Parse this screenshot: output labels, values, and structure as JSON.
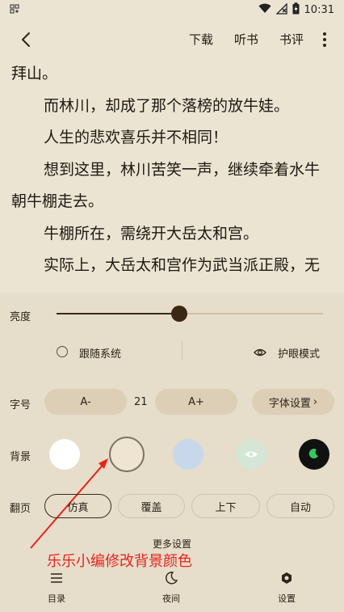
{
  "status_bar": {
    "time": "10:31",
    "left_icon": "qr-notification-icon",
    "icons": [
      "wifi-icon",
      "no-signal-icon",
      "battery-charging-icon"
    ]
  },
  "top_bar": {
    "back_icon": "back-arrow-icon",
    "actions": [
      "下载",
      "听书",
      "书评"
    ],
    "more_icon": "more-vertical-icon"
  },
  "content": {
    "lines": [
      {
        "text": "拜山。",
        "indent": false
      },
      {
        "text": "而林川，却成了那个落榜的放牛娃。",
        "indent": true
      },
      {
        "text": "人生的悲欢喜乐并不相同！",
        "indent": true
      },
      {
        "text": "想到这里，林川苦笑一声，继续牵着水牛",
        "indent": true
      },
      {
        "text": "朝牛棚走去。",
        "indent": false
      },
      {
        "text": "牛棚所在，需绕开大岳太和宫。",
        "indent": true
      },
      {
        "text": "实际上，大岳太和宫作为武当派正殿，无",
        "indent": true
      }
    ]
  },
  "settings": {
    "brightness": {
      "label": "亮度",
      "level": 0.46
    },
    "follow_system": {
      "label": "跟随系统",
      "checked": false
    },
    "eye_care": {
      "label": "护眼模式",
      "icon": "eye-icon"
    },
    "font_size": {
      "label": "字号",
      "decrease": "A-",
      "value": "21",
      "increase": "A+",
      "font_settings": "字体设置"
    },
    "background": {
      "label": "背景",
      "swatches": [
        {
          "name": "white",
          "color": "#ffffff"
        },
        {
          "name": "parchment",
          "color": "#efe3d2",
          "selected": true
        },
        {
          "name": "blue",
          "color": "#c8d8ea"
        },
        {
          "name": "green-eye",
          "color": "#d6e6d6",
          "icon": "eye-icon"
        },
        {
          "name": "night",
          "color": "#111111",
          "icon": "moon-icon"
        }
      ]
    },
    "page_turn": {
      "label": "翻页",
      "options": [
        "仿真",
        "覆盖",
        "上下",
        "自动"
      ],
      "selected": "仿真"
    },
    "more": "更多设置"
  },
  "annotation": "乐乐小编修改背景颜色",
  "bottom_nav": [
    {
      "label": "目录",
      "icon": "menu-list-icon"
    },
    {
      "label": "夜间",
      "icon": "moon-icon"
    },
    {
      "label": "设置",
      "icon": "gear-icon"
    }
  ],
  "colors": {
    "page_bg": "#ece4d3",
    "panel_bg": "#e6ddca",
    "accent": "#3a2814",
    "annotation": "#e8231d"
  }
}
